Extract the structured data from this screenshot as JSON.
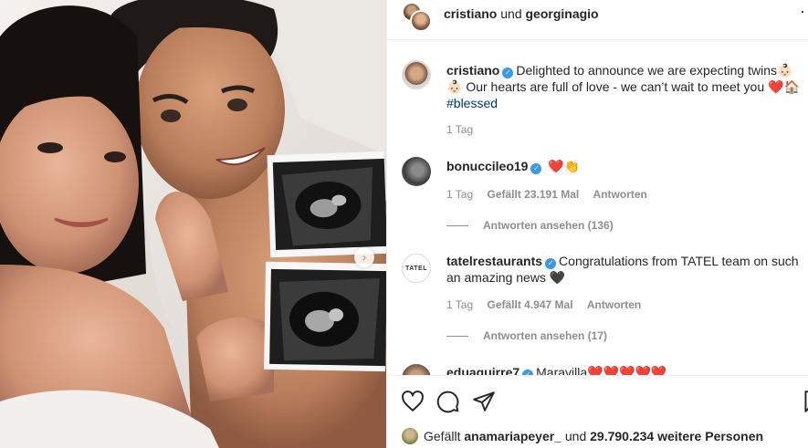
{
  "header": {
    "user1": "cristiano",
    "joiner": "und",
    "user2": "georginagio",
    "more_icon": "more-dots-icon"
  },
  "caption": {
    "username": "cristiano",
    "text": "Delighted to announce we are expecting twins👶🏻👶🏻 Our hearts are full of love - we can’t wait to meet you ❤️🏠",
    "hashtag": "#blessed",
    "time": "1 Tag"
  },
  "comments": [
    {
      "username": "bonucci​leo19",
      "text": "❤️👏",
      "time": "1 Tag",
      "likes": "Gefällt 23.191 Mal",
      "reply": "Antworten",
      "view_replies": "Antworten ansehen (136)"
    },
    {
      "username": "tatelrestaurants",
      "avatar_text": "TATEL",
      "text": "Congratulations from TATEL team on such an amazing news 🖤",
      "time": "1 Tag",
      "likes": "Gefällt 4.947 Mal",
      "reply": "Antworten",
      "view_replies": "Antworten ansehen (17)"
    },
    {
      "username": "eduaguirre7",
      "text": "Maravilla❤️❤️❤️❤️❤️"
    }
  ],
  "actions": {
    "like_icon": "heart-outline-icon",
    "comment_icon": "comment-bubble-icon",
    "share_icon": "paper-plane-icon",
    "save_icon": "bookmark-icon"
  },
  "likes": {
    "prefix": "Gefällt",
    "user": "anamariapeyer_",
    "middle": "und",
    "count": "29.790.234 weitere Personen"
  },
  "colors": {
    "verified": "#3897f0",
    "hashtag": "#00376b",
    "meta": "#8e8e8e",
    "heart": "#ed4956"
  }
}
